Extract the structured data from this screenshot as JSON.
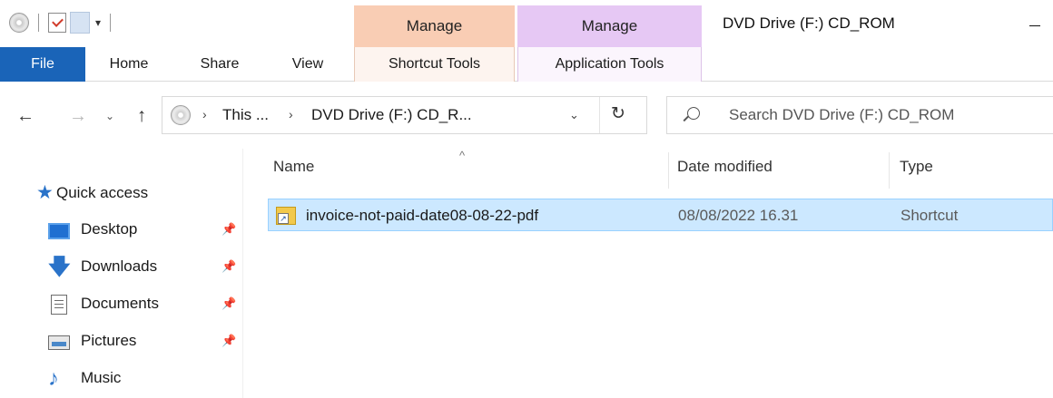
{
  "title_bar": {
    "context_tabs": {
      "shortcut_manage": "Manage",
      "app_manage": "Manage"
    },
    "window_title": "DVD Drive (F:) CD_ROM"
  },
  "ribbon": {
    "tabs": {
      "file": "File",
      "home": "Home",
      "share": "Share",
      "view": "View",
      "shortcut_tools": "Shortcut Tools",
      "application_tools": "Application Tools"
    },
    "colors": {
      "file_tab": "#1a64b8",
      "shortcut_context": "#f9cdb4",
      "app_context": "#e6c8f4"
    }
  },
  "navigation": {
    "back": "←",
    "forward": "→",
    "recent": "⌄",
    "up": "↑",
    "breadcrumb": [
      "This ...",
      "DVD Drive (F:) CD_R..."
    ],
    "breadcrumb_sep": "›",
    "dropdown": "⌄",
    "refresh": "↻",
    "search_placeholder": "Search DVD Drive (F:) CD_ROM"
  },
  "sidebar": {
    "quick_access": {
      "label": "Quick access",
      "icon": "star-icon",
      "glyph": "★"
    },
    "items": [
      {
        "label": "Desktop",
        "icon": "desktop-icon",
        "pinned": true
      },
      {
        "label": "Downloads",
        "icon": "downloads-icon",
        "glyph": "🡇",
        "pinned": true
      },
      {
        "label": "Documents",
        "icon": "documents-icon",
        "pinned": true
      },
      {
        "label": "Pictures",
        "icon": "pictures-icon",
        "pinned": true
      },
      {
        "label": "Music",
        "icon": "music-icon",
        "glyph": "♪",
        "pinned": false
      }
    ],
    "pin_glyph": "📌"
  },
  "file_list": {
    "sort_arrow": "^",
    "columns": {
      "name": "Name",
      "date_modified": "Date modified",
      "type": "Type"
    },
    "rows": [
      {
        "name": "invoice-not-paid-date08-08-22-pdf",
        "date_modified": "08/08/2022 16.31",
        "type": "Shortcut",
        "selected": true
      }
    ],
    "selection_color": "#cce8ff"
  }
}
